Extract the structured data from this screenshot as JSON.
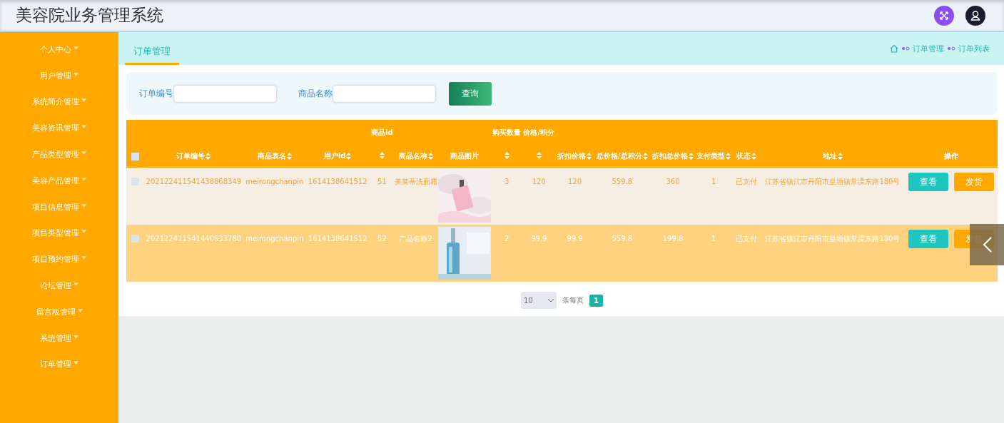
{
  "header": {
    "title": "美容院业务管理系统"
  },
  "sidebar": {
    "items": [
      {
        "label": "个人中心"
      },
      {
        "label": "用户管理"
      },
      {
        "label": "系统简介管理"
      },
      {
        "label": "美容资讯管理"
      },
      {
        "label": "产品类型管理"
      },
      {
        "label": "美容产品管理"
      },
      {
        "label": "项目信息管理"
      },
      {
        "label": "项目类型管理"
      },
      {
        "label": "项目预约管理"
      },
      {
        "label": "论坛管理"
      },
      {
        "label": "留言板管理"
      },
      {
        "label": "系统管理"
      },
      {
        "label": "订单管理"
      }
    ]
  },
  "tabs": [
    {
      "label": "订单管理",
      "selected": true
    }
  ],
  "breadcrumb": [
    "订单管理",
    "订单列表"
  ],
  "search": {
    "fields": [
      {
        "label": "订单编号"
      },
      {
        "label": "商品名称"
      }
    ],
    "button": "查询"
  },
  "table": {
    "all_checked": false,
    "columns": [
      {
        "kind": "text",
        "label": "订单编号",
        "sortable": true
      },
      {
        "kind": "text",
        "label": "商品表名",
        "sortable": true
      },
      {
        "kind": "text",
        "label": "用户id",
        "sortable": true
      },
      {
        "kind": "text",
        "top": "商品id",
        "sortable": true
      },
      {
        "kind": "text",
        "label": "商品名称",
        "sortable": true
      },
      {
        "label": "商品图片",
        "sortable": false
      },
      {
        "kind": "text",
        "top": "购买数量",
        "sortable": true
      },
      {
        "kind": "text",
        "top": "价格/积分",
        "sortable": true
      },
      {
        "kind": "text",
        "label": "折扣价格",
        "sortable": true
      },
      {
        "kind": "text",
        "label": "总价格/总积分",
        "sortable": true
      },
      {
        "kind": "text",
        "label": "折扣总价格",
        "sortable": true
      },
      {
        "kind": "text",
        "label": "支付类型",
        "sortable": true
      },
      {
        "kind": "text",
        "label": "状态",
        "sortable": true
      },
      {
        "kind": "text",
        "label": "地址",
        "sortable": true
      },
      {
        "kind": "actions",
        "label": "操作",
        "sortable": false
      }
    ],
    "rows": [
      {
        "checked": false,
        "hovered": false,
        "cells": [
          "202122411541438868349",
          "meirongchanpin",
          "1614138641512",
          "51",
          "美莱蒂洗面霜",
          "",
          "3",
          "120",
          "120",
          "559.8",
          "360",
          "1",
          "已支付",
          "江苏省镇江市丹阳市皇塘镇常溧东路180号"
        ],
        "actions": [
          "查看",
          "发货"
        ]
      },
      {
        "checked": false,
        "hovered": true,
        "cells": [
          "202122411541440633780",
          "meirongchanpin",
          "1614138641512",
          "52",
          "产品名称2",
          "",
          "2",
          "99.9",
          "99.9",
          "559.8",
          "199.8",
          "1",
          "已支付",
          "江苏省镇江市丹阳市皇塘镇常溧东路180号"
        ],
        "actions": [
          "查看",
          "发货"
        ]
      }
    ]
  },
  "pagination": {
    "page_size": "10",
    "page_size_label": "条每页",
    "pages": [
      {
        "label": "1",
        "selected": true
      }
    ]
  }
}
